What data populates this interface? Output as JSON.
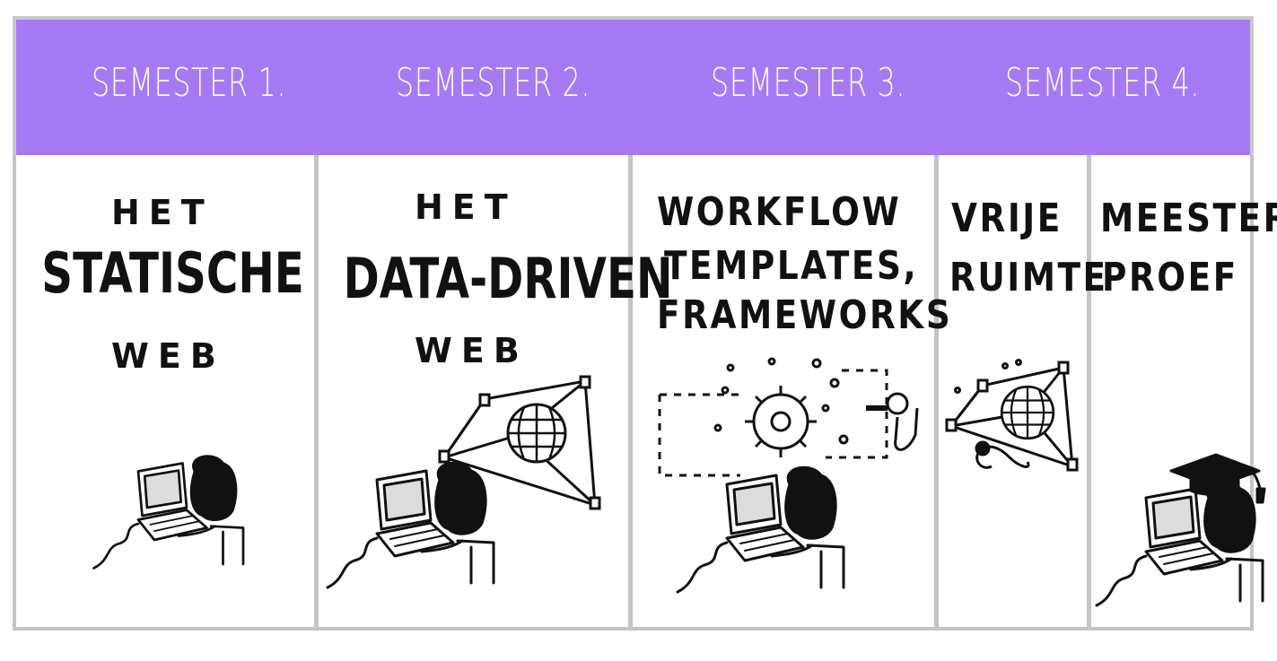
{
  "semesters": [
    {
      "header": "SEMESTER 1.",
      "lines": [
        "HET",
        "STATISCHE",
        "WEB"
      ]
    },
    {
      "header": "SEMESTER 2.",
      "lines": [
        "HET",
        "DATA-DRIVEN",
        "WEB"
      ]
    },
    {
      "header": "SEMESTER 3.",
      "lines": [
        "WORKFLOW",
        "TEMPLATES,",
        "FRAMEWORKS"
      ]
    },
    {
      "header": "SEMESTER 4.",
      "parts": [
        {
          "lines": [
            "VRIJE",
            "RUIMTE"
          ]
        },
        {
          "lines": [
            "MEESTER",
            "PROEF"
          ]
        }
      ]
    }
  ],
  "colors": {
    "header_bg": "#a67af4",
    "header_text": "#ffffff",
    "ink": "#111111",
    "frame": "#c4c4c4"
  }
}
